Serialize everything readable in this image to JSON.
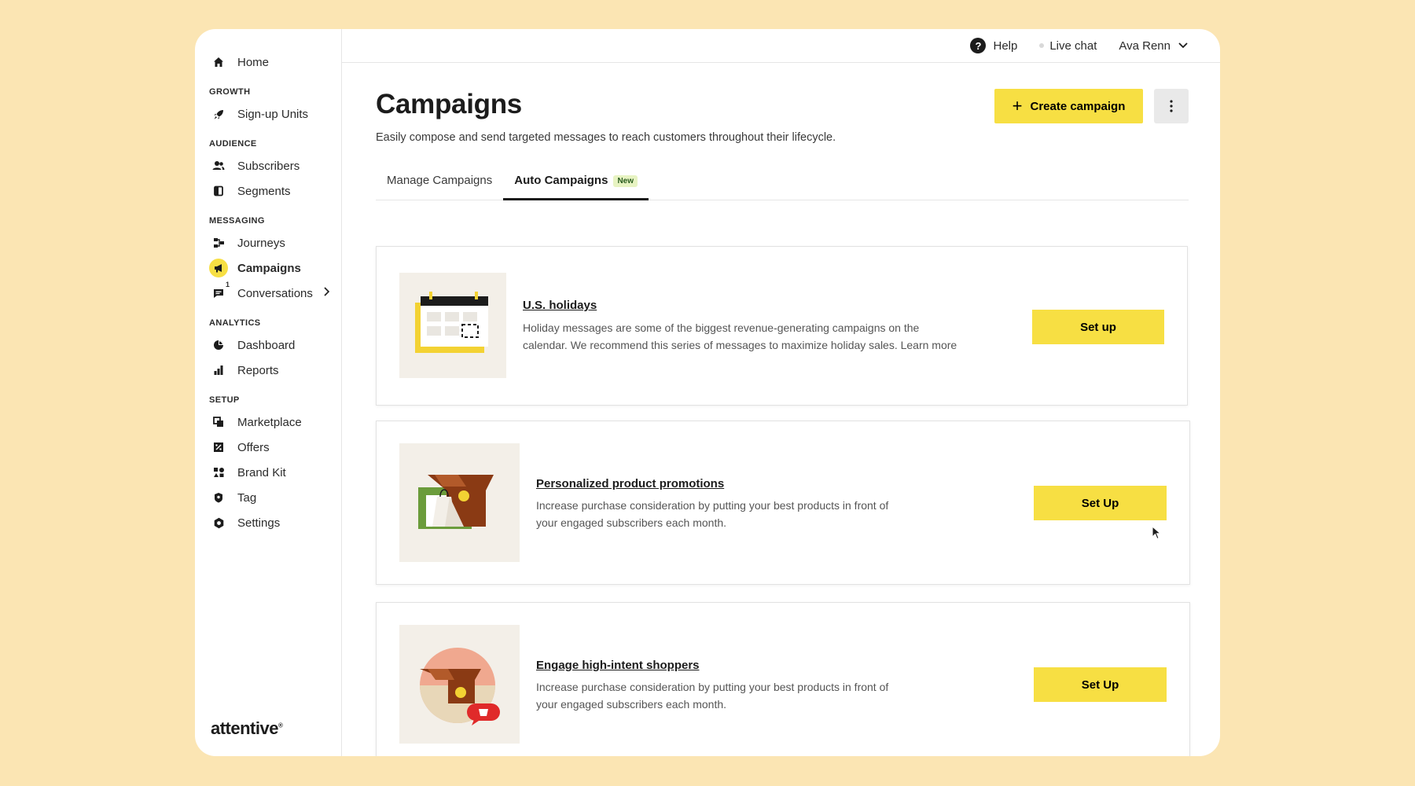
{
  "sidebar": {
    "home": "Home",
    "sections": {
      "growth": "GROWTH",
      "audience": "AUDIENCE",
      "messaging": "MESSAGING",
      "analytics": "ANALYTICS",
      "setup": "SETUP"
    },
    "items": {
      "signup_units": "Sign-up Units",
      "subscribers": "Subscribers",
      "segments": "Segments",
      "journeys": "Journeys",
      "campaigns": "Campaigns",
      "conversations": "Conversations",
      "conversations_count": "1",
      "dashboard": "Dashboard",
      "reports": "Reports",
      "marketplace": "Marketplace",
      "offers": "Offers",
      "brand_kit": "Brand Kit",
      "tag": "Tag",
      "settings": "Settings"
    },
    "logo": "attentive"
  },
  "topbar": {
    "help": "Help",
    "live_chat": "Live chat",
    "user": "Ava Renn"
  },
  "header": {
    "title": "Campaigns",
    "subtitle": "Easily compose and send targeted messages to reach customers throughout their lifecycle.",
    "create_button": "Create campaign"
  },
  "tabs": {
    "manage": "Manage Campaigns",
    "auto": "Auto Campaigns",
    "new_badge": "New"
  },
  "cards": [
    {
      "title": "U.S. holidays",
      "desc_line1": "Holiday messages are some of the biggest revenue-generating campaigns on the",
      "desc_line2": "calendar. We recommend this series of messages to maximize holiday sales. Learn more",
      "button": "Set up"
    },
    {
      "title": "Personalized product promotions",
      "desc_line1": "Increase purchase consideration by putting your best products in front of",
      "desc_line2": "your engaged subscribers each month.",
      "button": "Set Up"
    },
    {
      "title": "Engage high-intent shoppers",
      "desc_line1": "Increase purchase consideration by putting your best products in front of",
      "desc_line2": "your engaged subscribers each month.",
      "button": "Set Up"
    }
  ],
  "colors": {
    "accent": "#f7df43",
    "background": "#fbe5b3"
  }
}
